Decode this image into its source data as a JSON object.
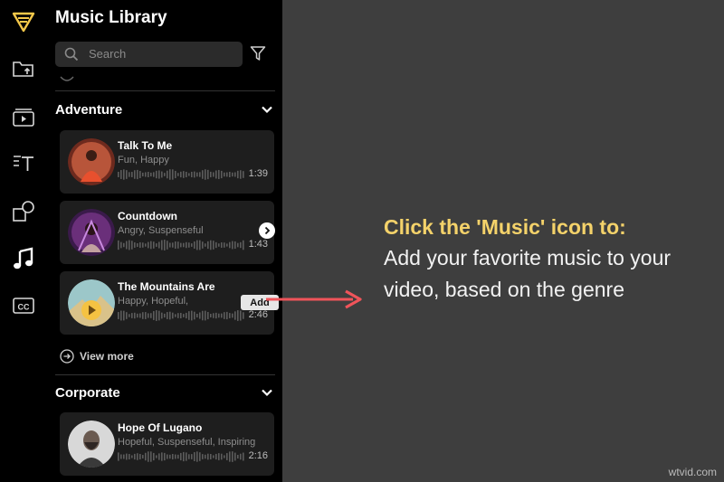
{
  "sidebar": {
    "icons": [
      "logo-icon",
      "upload-folder-icon",
      "media-icon",
      "text-icon",
      "shapes-icon",
      "music-icon",
      "closed-captions-icon"
    ]
  },
  "panel": {
    "title": "Music Library",
    "search_placeholder": "Search",
    "sections": [
      {
        "label": "Adventure",
        "tracks": [
          {
            "title": "Talk To Me",
            "tags": "Fun, Happy",
            "duration": "1:39"
          },
          {
            "title": "Countdown",
            "tags": "Angry, Suspenseful",
            "duration": "1:43"
          },
          {
            "title": "The Mountains Are",
            "tags": "Happy, Hopeful,",
            "duration": "2:46",
            "action": "Add"
          }
        ],
        "view_more": "View more"
      },
      {
        "label": "Corporate",
        "tracks": [
          {
            "title": "Hope Of Lugano",
            "tags": "Hopeful, Suspenseful, Inspiring",
            "duration": "2:16"
          }
        ]
      }
    ]
  },
  "callout": {
    "heading": "Click the 'Music' icon to:",
    "body": "Add your favorite music to your video, based on the genre"
  },
  "watermark": "wtvid.com",
  "colors": {
    "highlight": "#f4d26a",
    "arrow": "#f0545a",
    "panel_bg": "#000000",
    "card_bg": "#1e1e1e"
  }
}
